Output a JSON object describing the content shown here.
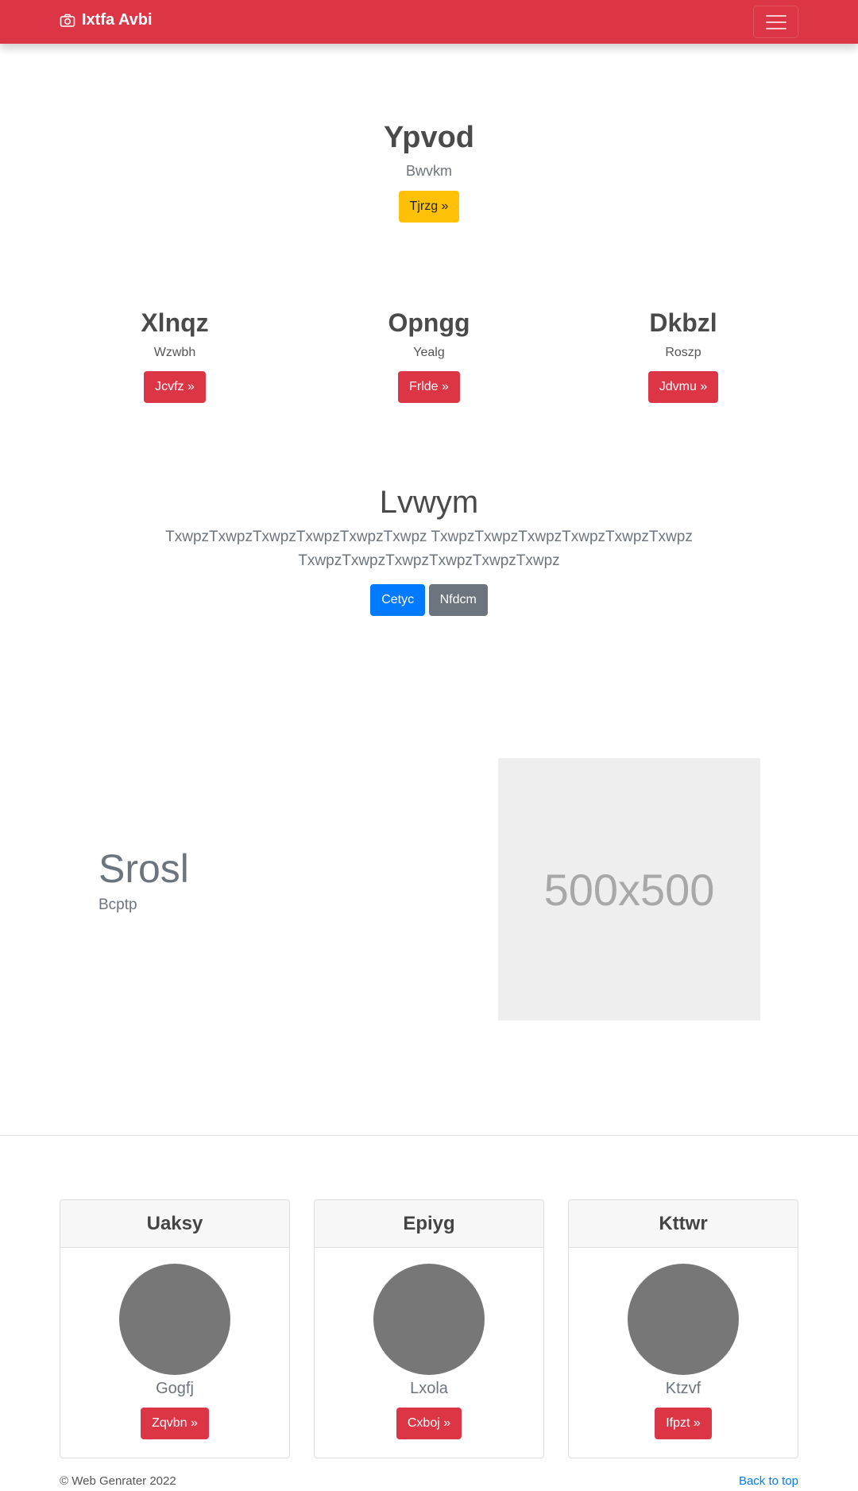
{
  "navbar": {
    "brand": "Ixtfa Avbi",
    "brand_icon": "camera-icon",
    "toggler_icon": "hamburger-icon"
  },
  "hero": {
    "title": "Ypvod",
    "subtitle": "Bwvkm",
    "button": "Tjrzg »"
  },
  "columns": [
    {
      "title": "Xlnqz",
      "subtitle": "Wzwbh",
      "button": "Jcvfz »"
    },
    {
      "title": "Opngg",
      "subtitle": "Yealg",
      "button": "Frlde »"
    },
    {
      "title": "Dkbzl",
      "subtitle": "Roszp",
      "button": "Jdvmu »"
    }
  ],
  "lead": {
    "title": "Lvwym",
    "line1": "TxwpzTxwpzTxwpzTxwpzTxwpzTxwpz TxwpzTxwpzTxwpzTxwpzTxwpzTxwpz",
    "line2": "TxwpzTxwpzTxwpzTxwpzTxwpzTxwpz",
    "primary_button": "Cetyc",
    "secondary_button": "Nfdcm"
  },
  "feature": {
    "title": "Srosl",
    "subtitle": "Bcptp",
    "placeholder_text": "500x500"
  },
  "cards": [
    {
      "header": "Uaksy",
      "name": "Gogfj",
      "button": "Zqvbn »"
    },
    {
      "header": "Epiyg",
      "name": "Lxola",
      "button": "Cxboj »"
    },
    {
      "header": "Kttwr",
      "name": "Ktzvf",
      "button": "Ifpzt »"
    }
  ],
  "footer": {
    "copyright": "© Web Genrater 2022",
    "back_to_top": "Back to top"
  },
  "colors": {
    "brand_red": "#dc3545",
    "warning": "#ffc107",
    "primary": "#007bff",
    "secondary": "#6c757d"
  }
}
